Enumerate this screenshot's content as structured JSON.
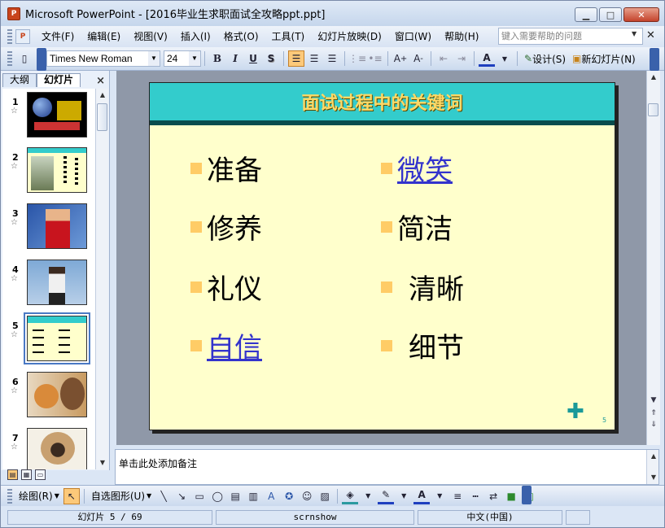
{
  "window": {
    "title": "Microsoft PowerPoint - [2016毕业生求职面试全攻略ppt.ppt]",
    "app_icon": "P"
  },
  "menu": {
    "items": [
      "文件(F)",
      "编辑(E)",
      "视图(V)",
      "插入(I)",
      "格式(O)",
      "工具(T)",
      "幻灯片放映(D)",
      "窗口(W)",
      "帮助(H)"
    ],
    "help_placeholder": "键入需要帮助的问题"
  },
  "toolbar": {
    "font_name": "Times New Roman",
    "font_size": "24",
    "bold": "B",
    "italic": "I",
    "underline": "U",
    "shadow": "S",
    "design_label": "设计(S)",
    "new_slide_label": "新幻灯片(N)"
  },
  "panel": {
    "tab_outline": "大纲",
    "tab_slides": "幻灯片",
    "close": "×",
    "slides": [
      {
        "num": "1"
      },
      {
        "num": "2"
      },
      {
        "num": "3"
      },
      {
        "num": "4"
      },
      {
        "num": "5"
      },
      {
        "num": "6"
      },
      {
        "num": "7"
      }
    ],
    "selected_slide": "5"
  },
  "slide": {
    "title": "面试过程中的关键词",
    "bullets_left": [
      "准备",
      "修养",
      "礼仪",
      "自信"
    ],
    "bullets_right": [
      "微笑",
      "简洁",
      "清晰",
      "细节"
    ],
    "page_number": "5",
    "nav_symbol": "✚"
  },
  "notes": {
    "placeholder": "单击此处添加备注"
  },
  "drawbar": {
    "draw_label": "绘图(R)",
    "autoshapes_label": "自选图形(U)"
  },
  "status": {
    "slide_pos": "幻灯片 5 / 69",
    "design": "scrnshow",
    "language": "中文(中国)"
  },
  "colors": {
    "slide_bg": "#ffffcc",
    "title_band": "#33cccc",
    "title_text": "#ffd966",
    "bullet": "#ffcc66",
    "link": "#3333cc"
  }
}
